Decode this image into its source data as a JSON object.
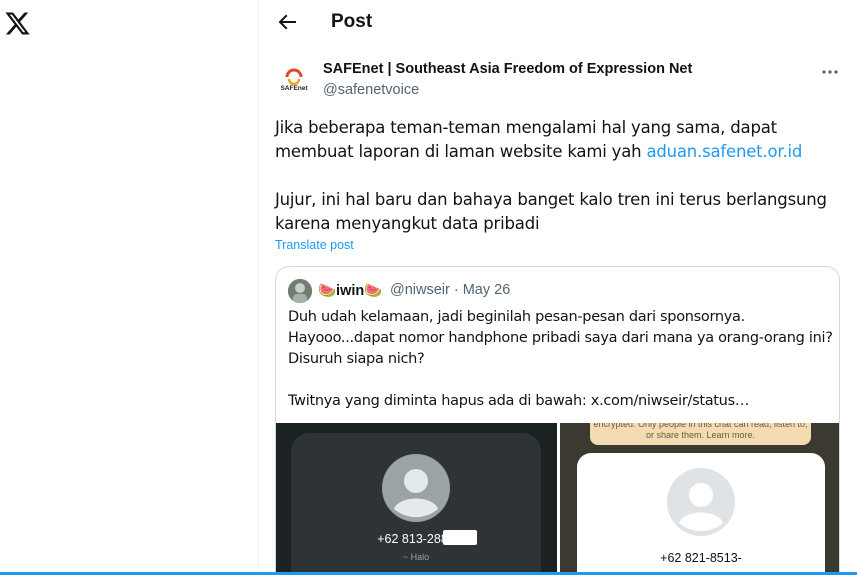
{
  "app": {
    "logo_icon": "x-logo-icon"
  },
  "header": {
    "back_icon": "arrow-left-icon",
    "title": "Post"
  },
  "post": {
    "author_name": "SAFEnet | Southeast Asia Freedom of Expression Net",
    "author_handle": "@safenetvoice",
    "avatar_text": "SAFEnet",
    "more_icon": "more-dots-icon",
    "text_p1_before_link": "Jika beberapa teman-teman mengalami hal yang sama, dapat membuat laporan di laman website kami yah ",
    "text_link": "aduan.safenet.or.id",
    "text_p2": "Jujur, ini hal baru dan bahaya banget kalo tren ini terus berlangsung karena menyangkut data pribadi",
    "translate_label": "Translate post"
  },
  "quote": {
    "name": "🍉iwin🍉",
    "handle_date": "@niwseir · May 26",
    "lines": [
      "Duh udah kelamaan, jadi beginilah pesan-pesan dari sponsornya.",
      "Hayooo...dapat nomor handphone pribadi saya dari mana ya orang-orang ini?",
      "Disuruh siapa nich?"
    ],
    "link_line": "Twitnya yang diminta hapus ada di bawah:  x.com/niwseir/status…",
    "media": {
      "left_number": "+62 813-2881",
      "left_sub": "~ Halo",
      "right_encrypted_text": "encrypted. Only people in this chat can read, listen to, or share them. Learn more.",
      "right_number": "+62 821-8513-"
    }
  },
  "colors": {
    "accent": "#1d9bf0",
    "text": "#0f1419",
    "muted": "#536471",
    "border": "#cfd9de"
  }
}
